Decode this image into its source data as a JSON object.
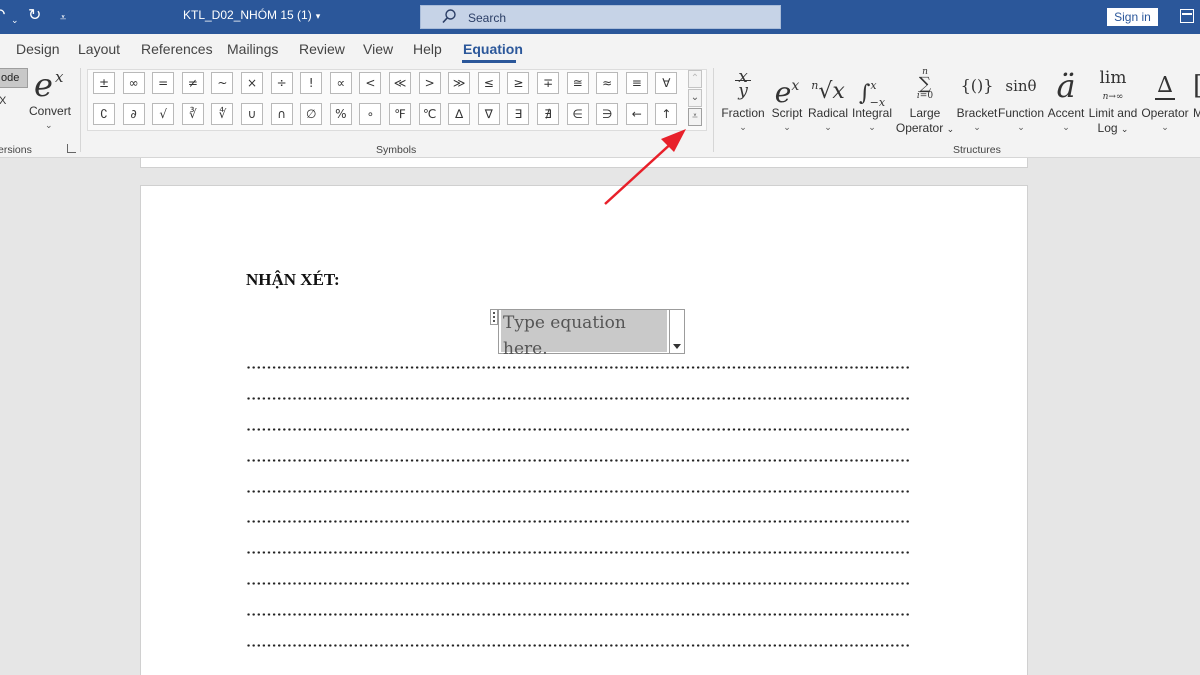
{
  "titlebar": {
    "doc_title": "KTL_D02_NHÓM 15 (1)",
    "search_placeholder": "Search",
    "sign_in": "Sign in",
    "bg_color": "#2b579a"
  },
  "tabs": [
    {
      "label": "Design"
    },
    {
      "label": "Layout"
    },
    {
      "label": "References"
    },
    {
      "label": "Mailings"
    },
    {
      "label": "Review"
    },
    {
      "label": "View"
    },
    {
      "label": "Help"
    },
    {
      "label": "Equation",
      "active": true
    }
  ],
  "conversions": {
    "mode_label": "ode",
    "x_label": "X",
    "convert_label": "Convert",
    "group_label": "ersions"
  },
  "symbols": {
    "group_label": "Symbols",
    "row1": [
      "±",
      "∞",
      "=",
      "≠",
      "~",
      "×",
      "÷",
      "!",
      "∝",
      "<",
      "≪",
      ">",
      "≫",
      "≤",
      "≥",
      "∓",
      "≅",
      "≈",
      "≡",
      "∀"
    ],
    "row2": [
      "∁",
      "∂",
      "√",
      "∛",
      "∜",
      "∪",
      "∩",
      "∅",
      "%",
      "∘",
      "℉",
      "℃",
      "∆",
      "∇",
      "∃",
      "∄",
      "∈",
      "∋",
      "←",
      "↑"
    ]
  },
  "structures": {
    "group_label": "Structures",
    "items": [
      {
        "label": "Fraction",
        "icon": "fraction-icon"
      },
      {
        "label": "Script",
        "icon": "script-icon"
      },
      {
        "label": "Radical",
        "icon": "radical-icon"
      },
      {
        "label": "Integral",
        "icon": "integral-icon"
      },
      {
        "label": "Large",
        "label2": "Operator",
        "icon": "large-operator-icon"
      },
      {
        "label": "Bracket",
        "icon": "bracket-icon"
      },
      {
        "label": "Function",
        "icon": "function-icon"
      },
      {
        "label": "Accent",
        "icon": "accent-icon"
      },
      {
        "label": "Limit and",
        "label2": "Log",
        "icon": "limit-log-icon"
      },
      {
        "label": "Operator",
        "icon": "operator-icon"
      }
    ]
  },
  "document": {
    "heading": "NHẬN XÉT:",
    "equation_placeholder": "Type equation here."
  },
  "annotation": {
    "arrow_color": "#e8202a"
  }
}
